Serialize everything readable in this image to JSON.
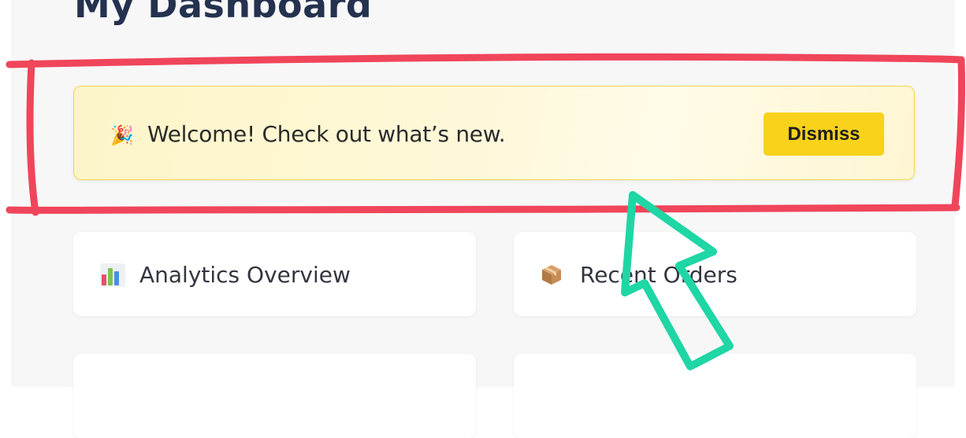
{
  "page": {
    "title": "My Dashboard"
  },
  "banner": {
    "emoji": "🎉",
    "message": "Welcome! Check out what’s new.",
    "dismiss_label": "Dismiss"
  },
  "cards": [
    {
      "icon": "bar-chart-icon",
      "label": "Analytics Overview"
    },
    {
      "icon": "package-icon",
      "label": "Recent Orders"
    },
    {
      "icon": "partially-visible-icon",
      "label": ""
    },
    {
      "icon": "partially-visible-icon",
      "label": ""
    }
  ],
  "annotations": {
    "highlight_color": "#f0455a",
    "arrow_color": "#1fd6a5"
  },
  "colors": {
    "title": "#24324f",
    "banner_background": "#fef8d8",
    "banner_border": "#f2d64a",
    "dismiss_button": "#f8d21b",
    "page_background": "#f7f7f8"
  }
}
